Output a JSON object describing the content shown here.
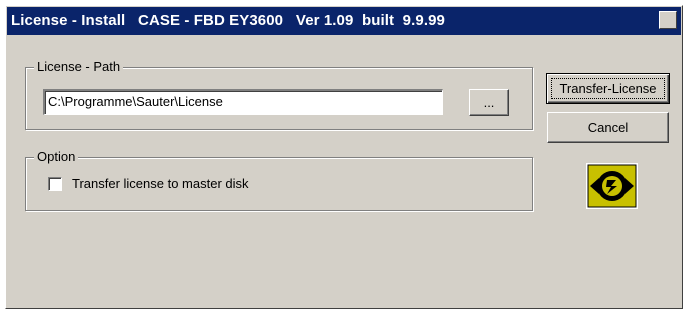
{
  "window": {
    "title": "License - Install   CASE - FBD EY3600   Ver 1.09  built  9.9.99",
    "close_glyph": "×"
  },
  "license_path": {
    "legend": "License - Path",
    "path_value": "C:\\Programme\\Sauter\\License",
    "browse_label": "..."
  },
  "option": {
    "legend": "Option",
    "transfer_to_master_label": "Transfer license to master disk",
    "transfer_to_master_checked": false
  },
  "actions": {
    "transfer_label": "Transfer-License",
    "cancel_label": "Cancel"
  },
  "icon": {
    "name": "sauter-logo-icon"
  },
  "colors": {
    "titlebar": "#0a246a",
    "dialog_face": "#d4d0c8",
    "logo_background": "#c8c000",
    "logo_foreground": "#000000"
  }
}
